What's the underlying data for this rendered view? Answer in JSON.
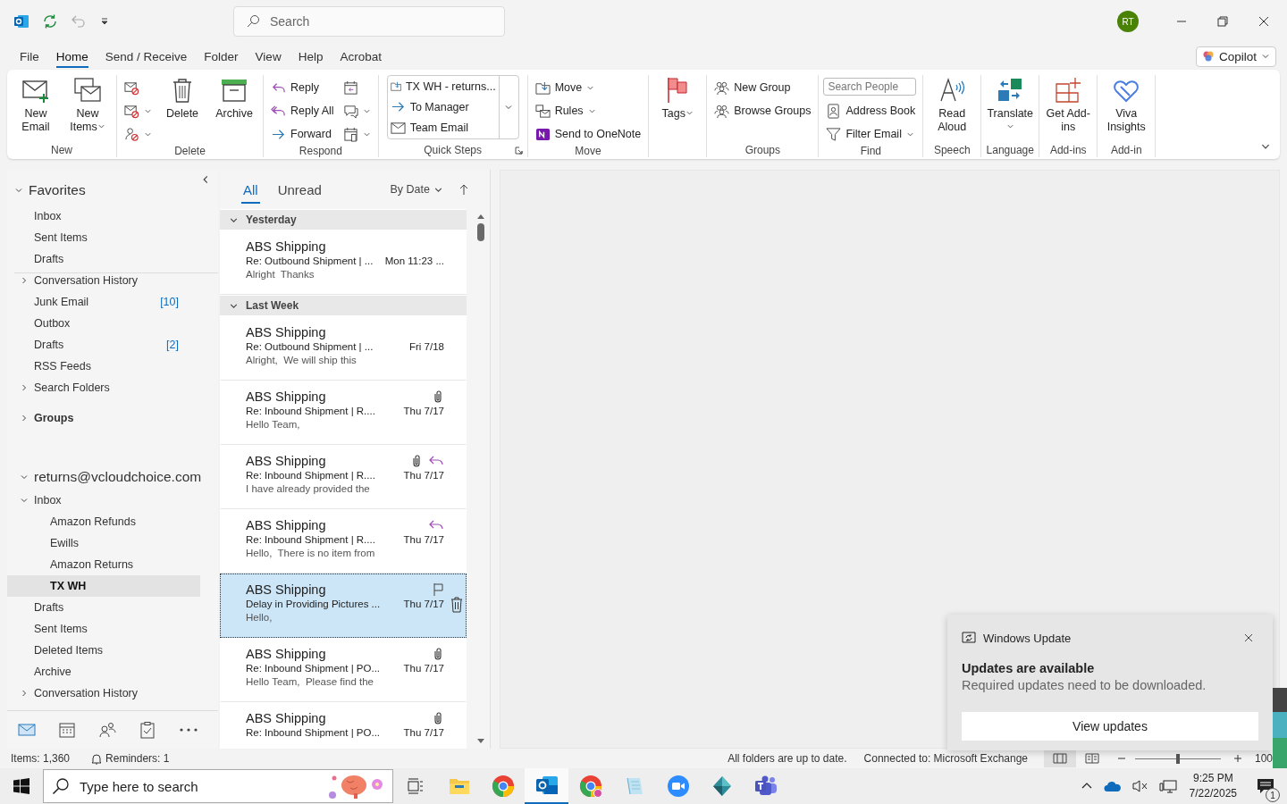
{
  "title_bar": {
    "search_placeholder": "Search",
    "avatar": "RT",
    "undo_disabled": true
  },
  "menu_tabs": [
    {
      "label": "File",
      "selected": false
    },
    {
      "label": "Home",
      "selected": true
    },
    {
      "label": "Send / Receive",
      "selected": false
    },
    {
      "label": "Folder",
      "selected": false
    },
    {
      "label": "View",
      "selected": false
    },
    {
      "label": "Help",
      "selected": false
    },
    {
      "label": "Acrobat",
      "selected": false
    }
  ],
  "copilot": "Copilot",
  "ribbon": {
    "groups": [
      {
        "label": "New",
        "items": [
          {
            "kind": "large",
            "label": "New Email",
            "dropdown": false
          },
          {
            "kind": "large",
            "label": "New Items",
            "dropdown": true
          }
        ]
      },
      {
        "label": "Delete",
        "items": [
          {
            "kind": "stack",
            "entries": [
              {
                "dropdown": false
              },
              {
                "dropdown": true
              },
              {
                "dropdown": true
              }
            ]
          },
          {
            "kind": "large",
            "label": "Delete",
            "dropdown": false
          },
          {
            "kind": "large",
            "label": "Archive",
            "dropdown": false
          }
        ]
      },
      {
        "label": "Respond",
        "items": [
          {
            "kind": "stack",
            "entries": [
              {
                "label": "Reply",
                "dropdown": false
              },
              {
                "label": "Reply All",
                "dropdown": false
              },
              {
                "label": "Forward",
                "dropdown": false
              }
            ]
          },
          {
            "kind": "stack",
            "entries": [
              {
                "dropdown": false
              },
              {
                "dropdown": true
              },
              {
                "dropdown": true
              }
            ]
          }
        ]
      },
      {
        "label": "Quick Steps",
        "launcher": true,
        "items": [
          {
            "kind": "gallery",
            "entries": [
              {
                "label": "TX WH - returns..."
              },
              {
                "label": "To Manager"
              },
              {
                "label": "Team Email"
              }
            ]
          }
        ]
      },
      {
        "label": "Move",
        "items": [
          {
            "kind": "stack",
            "entries": [
              {
                "label": "Move",
                "dropdown": true
              },
              {
                "label": "Rules",
                "dropdown": true
              },
              {
                "label": "Send to OneNote",
                "dropdown": false
              }
            ]
          }
        ]
      },
      {
        "items": [
          {
            "kind": "large",
            "label": "Tags",
            "dropdown": true
          }
        ]
      },
      {
        "label": "Groups",
        "items": [
          {
            "kind": "stack",
            "entries": [
              {
                "label": "New Group",
                "dropdown": false
              },
              {
                "label": "Browse Groups",
                "dropdown": false
              }
            ]
          }
        ]
      },
      {
        "label": "Find",
        "items": [
          {
            "kind": "stack",
            "entries": [
              {
                "kind": "search",
                "placeholder": "Search People"
              },
              {
                "kind": "button",
                "label": "Address Book",
                "dropdown": false
              },
              {
                "kind": "button",
                "label": "Filter Email",
                "dropdown": true
              }
            ]
          }
        ]
      },
      {
        "label": "Speech",
        "items": [
          {
            "kind": "large",
            "label": "Read Aloud",
            "dropdown": false
          }
        ]
      },
      {
        "label": "Language",
        "items": [
          {
            "kind": "large",
            "label": "Translate",
            "dropdown": true
          }
        ]
      },
      {
        "label": "Add-ins",
        "items": [
          {
            "kind": "large",
            "label": "Get Add-ins",
            "dropdown": false
          }
        ]
      },
      {
        "label": "Add-in",
        "items": [
          {
            "kind": "large",
            "label": "Viva Insights",
            "dropdown": false
          }
        ]
      }
    ]
  },
  "folders": {
    "favorites": {
      "label": "Favorites",
      "expanded": true,
      "items": [
        {
          "label": "Inbox",
          "selected": false
        },
        {
          "label": "Sent Items",
          "selected": false
        },
        {
          "label": "Drafts",
          "selected": false
        }
      ]
    },
    "tree": [
      {
        "kind": "folder",
        "label": "Conversation History",
        "expanded": false,
        "selected": false
      },
      {
        "kind": "folder",
        "label": "Junk Email",
        "count": "[10]",
        "selected": false
      },
      {
        "kind": "folder",
        "label": "Outbox",
        "selected": false
      },
      {
        "kind": "folder",
        "label": "Drafts",
        "count": "[2]",
        "selected": false
      },
      {
        "kind": "folder",
        "label": "RSS Feeds",
        "selected": false
      },
      {
        "kind": "folder",
        "label": "Search Folders",
        "expanded": false,
        "selected": false
      },
      {
        "kind": "groups",
        "label": "Groups",
        "expanded": false,
        "selected": false
      },
      {
        "kind": "account",
        "label": "returns@vcloudchoice.com",
        "expanded": true,
        "selected": false,
        "children": [
          {
            "kind": "folder",
            "label": "Inbox",
            "expanded": true,
            "selected": false,
            "children": [
              {
                "kind": "folder",
                "label": "Amazon Refunds",
                "selected": false
              },
              {
                "kind": "folder",
                "label": "Ewills",
                "selected": false
              },
              {
                "kind": "folder",
                "label": "Amazon Returns",
                "selected": false
              },
              {
                "kind": "folder",
                "label": "TX WH",
                "selected": true
              }
            ]
          },
          {
            "kind": "folder",
            "label": "Drafts",
            "selected": false
          },
          {
            "kind": "folder",
            "label": "Sent Items",
            "selected": false
          },
          {
            "kind": "folder",
            "label": "Deleted Items",
            "selected": false
          },
          {
            "kind": "folder",
            "label": "Archive",
            "selected": false
          },
          {
            "kind": "folder",
            "label": "Conversation History",
            "expanded": false,
            "selected": false
          }
        ]
      }
    ]
  },
  "nav": [
    {
      "selected": true
    },
    {
      "selected": false
    },
    {
      "selected": false
    },
    {
      "selected": false
    },
    {
      "selected": false
    }
  ],
  "message_list": {
    "filters": [
      {
        "label": "All",
        "selected": true
      },
      {
        "label": "Unread",
        "selected": false
      }
    ],
    "sort": "By Date",
    "groups": [
      {
        "label": "Yesterday",
        "expanded": true,
        "messages": [
          {
            "sender": "ABS Shipping",
            "subject": "Re: Outbound Shipment | ...",
            "date": "Mon 11:23 ...",
            "preview": "Alright  Thanks",
            "attachment": false,
            "replied": false,
            "selected": false
          }
        ]
      },
      {
        "label": "Last Week",
        "expanded": true,
        "messages": [
          {
            "sender": "ABS Shipping",
            "subject": "Re: Outbound Shipment | ...",
            "date": "Fri 7/18",
            "preview": "Alright,  We will ship this",
            "attachment": false,
            "replied": false,
            "selected": false
          },
          {
            "sender": "ABS Shipping",
            "subject": "Re: Inbound Shipment | R....",
            "date": "Thu 7/17",
            "preview": "Hello Team,",
            "attachment": true,
            "replied": false,
            "selected": false
          },
          {
            "sender": "ABS Shipping",
            "subject": "Re: Inbound Shipment | R....",
            "date": "Thu 7/17",
            "preview": "I have already provided the",
            "attachment": true,
            "replied": true,
            "selected": false
          },
          {
            "sender": "ABS Shipping",
            "subject": "Re: Inbound Shipment | R....",
            "date": "Thu 7/17",
            "preview": "Hello,  There is no item from",
            "attachment": false,
            "replied": true,
            "selected": false
          },
          {
            "sender": "ABS Shipping",
            "subject": "Delay in Providing Pictures ...",
            "date": "Thu 7/17",
            "preview": "Hello,",
            "attachment": false,
            "replied": false,
            "selected": true
          },
          {
            "sender": "ABS Shipping",
            "subject": "Re: Inbound Shipment | PO...",
            "date": "Thu 7/17",
            "preview": "Hello Team,  Please find the",
            "attachment": true,
            "replied": false,
            "selected": false
          },
          {
            "sender": "ABS Shipping",
            "subject": "Re: Inbound Shipment | PO...",
            "date": "Thu 7/17",
            "attachment": true,
            "replied": false,
            "selected": false
          }
        ]
      }
    ]
  },
  "status_bar": {
    "items": "Items: 1,360",
    "reminders": "Reminders: 1",
    "sync": "All folders are up to date.",
    "connection": "Connected to: Microsoft Exchange",
    "zoom": {
      "level": 0.5
    },
    "zoom_reading": "100"
  },
  "notification": {
    "app": "Windows Update",
    "title": "Updates are available",
    "body": "Required updates need to be downloaded.",
    "button": "View updates"
  },
  "taskbar": {
    "search_placeholder": "Type here to search",
    "apps": [
      {
        "selected": false
      },
      {
        "selected": false
      },
      {
        "selected": false
      },
      {
        "selected": true
      },
      {
        "selected": false
      },
      {
        "selected": false
      },
      {
        "selected": false
      },
      {
        "selected": false
      },
      {
        "selected": false
      }
    ],
    "time": "9:25 PM",
    "date": "7/22/2025",
    "notification_count": "1"
  }
}
